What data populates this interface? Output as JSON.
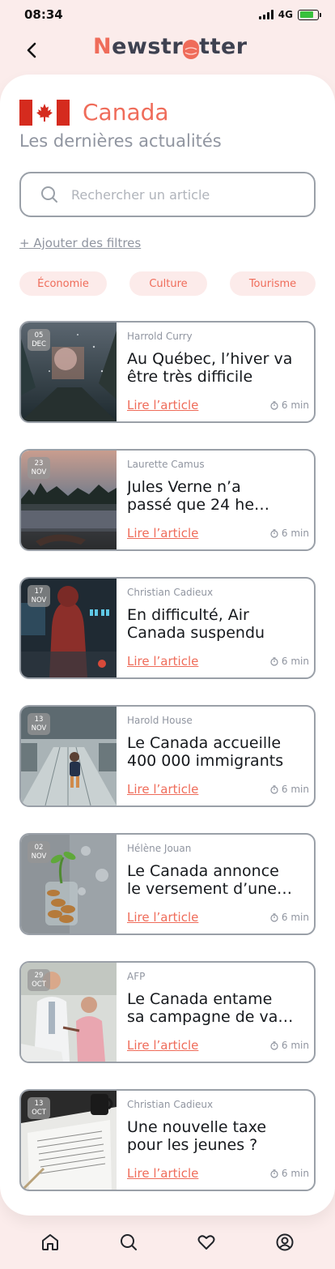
{
  "status": {
    "time": "08:34",
    "network": "4G",
    "battery_color": "#37c13c"
  },
  "header": {
    "back_icon": "chevron-left-icon",
    "logo_prefix": "N",
    "logo_part1": "ewstr",
    "logo_part2": "tter"
  },
  "country": {
    "name": "Canada",
    "flag": "canada-flag",
    "subtitle": "Les dernières actualités"
  },
  "search": {
    "placeholder": "Rechercher un article",
    "value": "",
    "icon": "search-icon"
  },
  "filters": {
    "add_label": "+ Ajouter des filtres",
    "chips": [
      "Économie",
      "Culture",
      "Tourisme"
    ]
  },
  "colors": {
    "accent": "#ef6c5a",
    "muted": "#9095a0",
    "border": "#9aa0a8",
    "background": "#fbeceb"
  },
  "articles": [
    {
      "day": "05",
      "month": "DEC",
      "author": "Harrold Curry",
      "title_l1": "Au Québec, l’hiver va",
      "title_l2": "être très difficile",
      "link": "Lire l’article",
      "time": "6 min"
    },
    {
      "day": "23",
      "month": "NOV",
      "author": "Laurette Camus",
      "title_l1": "Jules Verne n’a",
      "title_l2": "passé que 24 he…",
      "link": "Lire l’article",
      "time": "6 min"
    },
    {
      "day": "17",
      "month": "NOV",
      "author": "Christian Cadieux",
      "title_l1": "En difficulté, Air",
      "title_l2": "Canada suspendu",
      "link": "Lire l’article",
      "time": "6 min"
    },
    {
      "day": "13",
      "month": "NOV",
      "author": "Harold House",
      "title_l1": "Le Canada accueille",
      "title_l2": "400 000 immigrants",
      "link": "Lire l’article",
      "time": "6 min"
    },
    {
      "day": "02",
      "month": "NOV",
      "author": "Hélène Jouan",
      "title_l1": "Le Canada annonce",
      "title_l2": "le versement d’une…",
      "link": "Lire l’article",
      "time": "6 min"
    },
    {
      "day": "29",
      "month": "OCT",
      "author": "AFP",
      "title_l1": "Le Canada entame",
      "title_l2": "sa campagne de va…",
      "link": "Lire l’article",
      "time": "6 min"
    },
    {
      "day": "13",
      "month": "OCT",
      "author": "Christian Cadieux",
      "title_l1": "Une nouvelle taxe",
      "title_l2": "pour les jeunes ?",
      "link": "Lire l’article",
      "time": "6 min"
    }
  ],
  "nav": {
    "items": [
      "home-icon",
      "search-icon",
      "heart-icon",
      "profile-icon"
    ]
  }
}
